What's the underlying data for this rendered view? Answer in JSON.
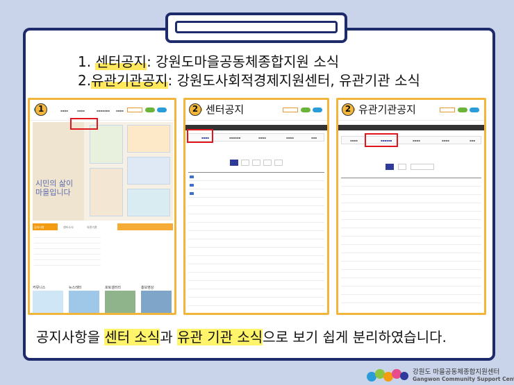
{
  "headings": {
    "line1_num": "1. ",
    "line1_key": "센터공지",
    "line1_rest": ": 강원도마을공동체종합지원 소식",
    "line2_num": "2.",
    "line2_key": "유관기관공지",
    "line2_rest": ": 강원도사회적경제지원센터, 유관기관 소식"
  },
  "panels": [
    {
      "badge": "1",
      "title": ""
    },
    {
      "badge": "2",
      "title": "센터공지"
    },
    {
      "badge": "2",
      "title": "유관기관공지"
    }
  ],
  "panel1": {
    "hero_text": "시민의 삶이\n마을입니다",
    "tabs": [
      "공지사항",
      "센터소식",
      "유관기관"
    ],
    "sections": [
      "커뮤니스",
      "뉴스레터",
      "포토갤러리",
      "홍보영상"
    ]
  },
  "bottom": {
    "pre": "공지사항을 ",
    "k1": "센터 소식",
    "mid": "과 ",
    "k2": "유관 기관 소식",
    "post": "으로 보기 쉽게 분리하였습니다."
  },
  "footer": {
    "korean": "강원도 마을공동체종합지원센터",
    "english": "Gangwon Community Support Center"
  },
  "colors": {
    "board_border": "#1d2b6b",
    "panel_border": "#f2b53b",
    "highlight": "#ffe85c",
    "red_box": "#e0141b"
  }
}
